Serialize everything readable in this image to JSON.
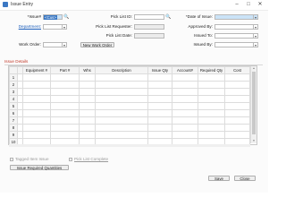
{
  "window": {
    "title": "Issue Entry"
  },
  "form": {
    "issue_label": "*Issue#",
    "issue_value": "<Cus>",
    "department_label": "Department:",
    "work_order_label": "Work Order:",
    "pick_list_id_label": "Pick List ID:",
    "pick_list_requester_label": "Pick List Requester:",
    "pick_list_date_label": "Pick List Date:",
    "new_work_order_button": "New Work Order",
    "date_of_issue_label": "*Date of Issue:",
    "approved_by_label": "Approved By:",
    "issued_to_label": "Issued To:",
    "issued_by_label": "Issued By:"
  },
  "details": {
    "section_title": "Issue Details",
    "columns": [
      "Equipment #",
      "Part #",
      "Whs",
      "Description",
      "Issue Qty",
      "Account#",
      "Required Qty",
      "Cost"
    ],
    "rows": [
      "1",
      "2",
      "3",
      "4",
      "5",
      "6",
      "7",
      "8",
      "9",
      "10",
      "11"
    ]
  },
  "footer": {
    "tagged_label": "Tagged Item Issue",
    "pick_list_complete_label": "Pick List Complete",
    "issue_required_button": "Issue Required Quantities",
    "save_button": "Save",
    "close_button": "Close"
  },
  "colors": {
    "accent": "#3b78c3",
    "section_title": "#c23a2b",
    "link": "#1a5dbb"
  },
  "icons": [
    "app-icon",
    "search-icon",
    "dropdown-arrow-icon",
    "minimize-icon",
    "maximize-icon",
    "close-icon"
  ]
}
